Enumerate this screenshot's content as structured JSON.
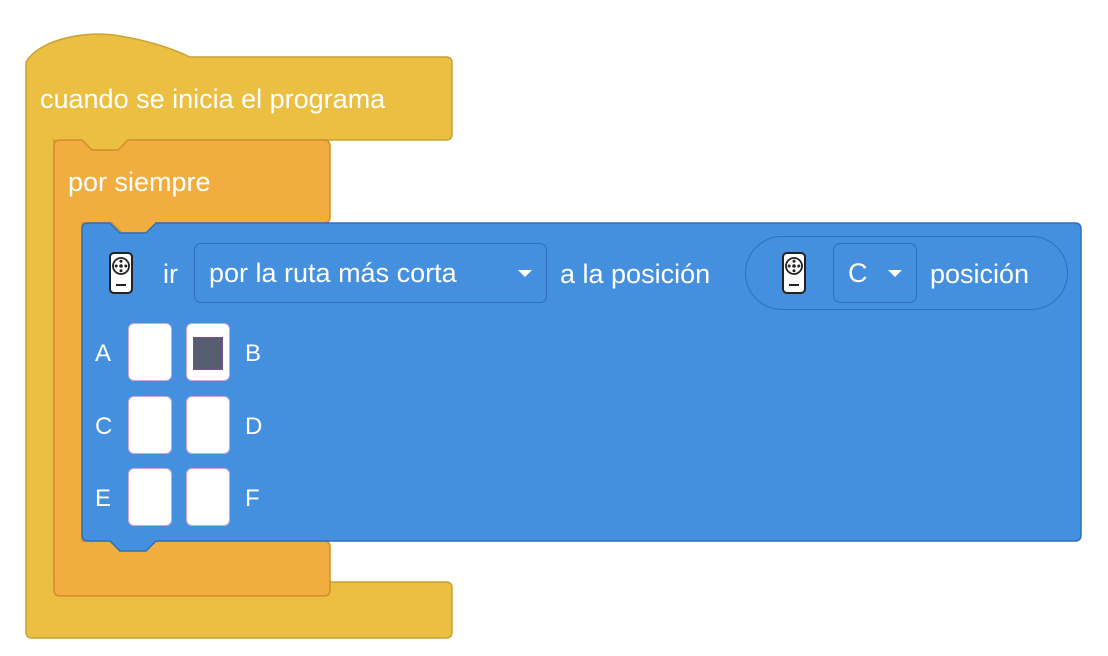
{
  "colors": {
    "event_block": "#ebbf42",
    "control_block": "#f1ad3f",
    "motion_block": "#4490de",
    "text": "#ffffff",
    "selected_cell": "#565d70"
  },
  "event_block": {
    "label": "cuando se inicia el programa"
  },
  "forever_block": {
    "label": "por siempre"
  },
  "go_block": {
    "icon": "motor-port-icon",
    "verb": "ir",
    "route_dropdown": {
      "value": "por la ruta más corta"
    },
    "to_position_label": "a la posición",
    "position_reporter": {
      "icon": "motor-port-icon",
      "port_dropdown": {
        "value": "C"
      },
      "label": "posición"
    },
    "port_grid": {
      "ports": [
        {
          "label": "A",
          "selected": false
        },
        {
          "label": "B",
          "selected": true
        },
        {
          "label": "C",
          "selected": false
        },
        {
          "label": "D",
          "selected": false
        },
        {
          "label": "E",
          "selected": false
        },
        {
          "label": "F",
          "selected": false
        }
      ]
    }
  }
}
